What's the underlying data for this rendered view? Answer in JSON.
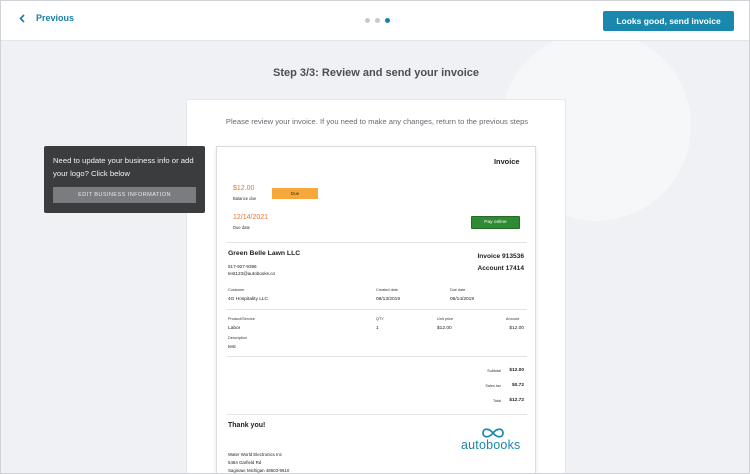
{
  "topbar": {
    "previous_label": "Previous",
    "primary_button": "Looks good, send invoice",
    "steps_total": 3,
    "steps_current": 3
  },
  "main": {
    "title": "Step 3/3: Review and send your invoice",
    "review_message": "Please review your invoice. If you need to make any changes, return to the previous steps"
  },
  "tooltip": {
    "text": "Need to update your business info or add your logo? Click below",
    "button": "EDIT BUSINESS INFORMATION"
  },
  "invoice": {
    "title": "Invoice",
    "amount": "$12.00",
    "balance_due_label": "Balance due",
    "status_badge": "Due",
    "due_date": "12/14/2021",
    "due_date_label": "Due date",
    "pay_button": "Pay online",
    "business": {
      "name": "Green Belle Lawn LLC",
      "phone": "517-927-9396",
      "email": "test123@autobooks.co"
    },
    "invoice_number": "Invoice 913536",
    "account_number": "Account 17414",
    "meta": {
      "customer_label": "Customer",
      "customer": "4G Hospitality LLC",
      "created_label": "Created date",
      "created": "08/13/2019",
      "due_label": "Due date",
      "due": "08/14/2019"
    },
    "line_headers": {
      "product": "Product/Service",
      "qty": "QTY",
      "unit_price": "Unit price",
      "amount": "Amount"
    },
    "line_item": {
      "product": "Labor",
      "qty": "1",
      "unit_price": "$12.00",
      "amount": "$12.00",
      "description_label": "Description",
      "description": "test"
    },
    "totals": {
      "subtotal_label": "Subtotal",
      "subtotal": "$12.00",
      "sales_tax_label": "Sales tax",
      "sales_tax": "$0.72",
      "total_label": "Total",
      "total": "$12.72"
    },
    "thank_you": "Thank you!",
    "brand_name": "autobooks",
    "remit": {
      "name": "Water World Electronics Inc",
      "street": "5484 Garfield Rd",
      "city": "Saginaw, Michigan 48603-9610"
    }
  },
  "colors": {
    "accent": "#1a87ad",
    "due_orange": "#e8752a",
    "badge_yellow": "#f7a83a",
    "pay_green": "#2f8a34",
    "tooltip_bg": "#3b3c3e"
  }
}
